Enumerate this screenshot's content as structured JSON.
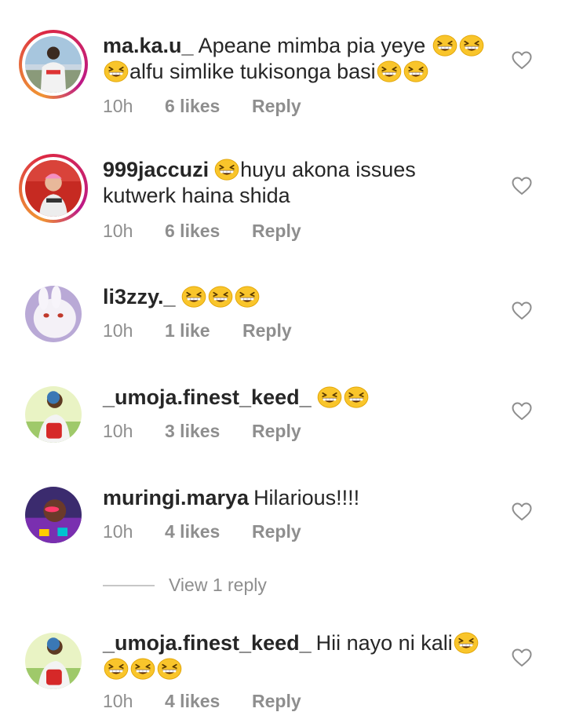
{
  "colors": {
    "text": "#262626",
    "meta": "#8e8e8e",
    "story_ring_start": "#f09433",
    "story_ring_end": "#bc1888"
  },
  "icons": {
    "emoji": "grinning-squinting-face-emoji",
    "like": "heart-outline-icon"
  },
  "comments": [
    {
      "username": "ma.ka.u_",
      "text1": "Apeane mimba pia yeye",
      "text2": "alfu simlike tukisonga basi",
      "time": "10h",
      "likes": "6 likes",
      "reply": "Reply"
    },
    {
      "username": "999jaccuzi",
      "text1": "huyu akona issues",
      "text2": "kutwerk haina shida",
      "time": "10h",
      "likes": "6 likes",
      "reply": "Reply"
    },
    {
      "username": "li3zzy._",
      "time": "10h",
      "likes": "1 like",
      "reply": "Reply"
    },
    {
      "username": "_umoja.finest_keed_",
      "time": "10h",
      "likes": "3 likes",
      "reply": "Reply"
    },
    {
      "username": "muringi.marya",
      "text1": "Hilarious!!!!",
      "time": "10h",
      "likes": "4 likes",
      "reply": "Reply",
      "view_replies": "View 1 reply"
    },
    {
      "username": "_umoja.finest_keed_",
      "text1": "Hii nayo ni kali",
      "time": "10h",
      "likes": "4 likes",
      "reply": "Reply"
    }
  ]
}
